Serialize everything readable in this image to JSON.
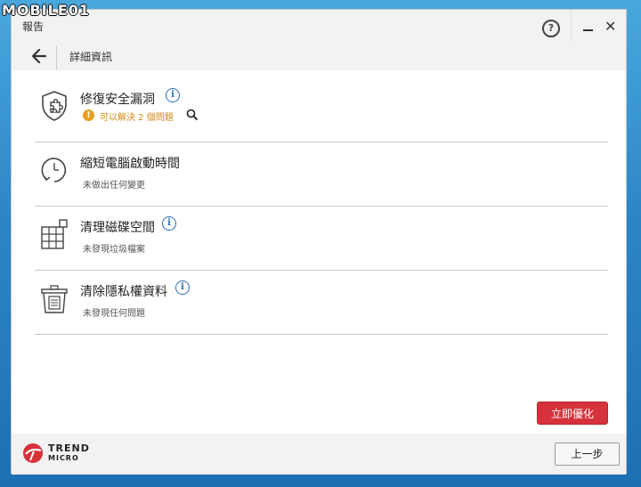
{
  "watermark": "MOBILE01",
  "window": {
    "title": "報告",
    "help_label": "?",
    "close_label": "✕"
  },
  "subheader": {
    "title": "詳細資訊"
  },
  "items": [
    {
      "title": "修復安全漏洞",
      "status": "可以解決 2 個問題",
      "has_warning": true,
      "icon": "shield-puzzle-icon"
    },
    {
      "title": "縮短電腦啟動時間",
      "status": "未做出任何變更",
      "icon": "clock-icon"
    },
    {
      "title": "清理磁碟空間",
      "status": "未發現垃圾檔案",
      "icon": "grid-icon"
    },
    {
      "title": "清除隱私權資料",
      "status": "未發現任何問題",
      "icon": "trash-icon"
    }
  ],
  "buttons": {
    "optimize": "立即優化",
    "previous": "上一步"
  },
  "logo": {
    "line1": "TREND",
    "line2": "MICRO"
  },
  "colors": {
    "accent_red": "#d6323b",
    "info_blue": "#2a6fb6",
    "warning_orange": "#e8a020"
  }
}
